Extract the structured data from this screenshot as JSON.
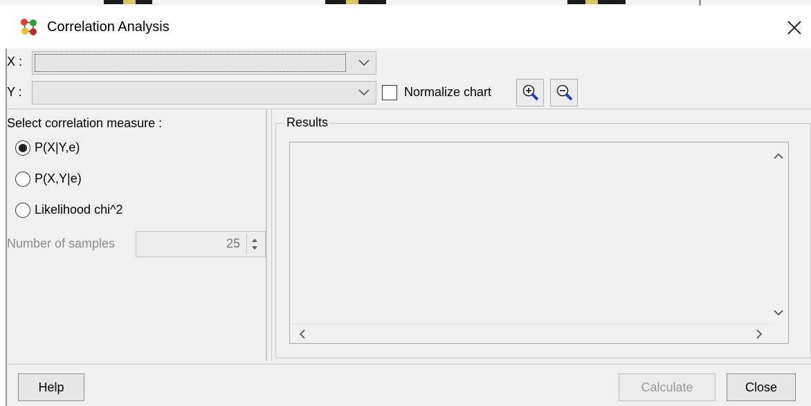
{
  "window": {
    "title": "Correlation Analysis"
  },
  "selectors": {
    "x_label": "X :",
    "y_label": "Y :",
    "x_value": "",
    "y_value": ""
  },
  "toolbar": {
    "normalize_label": "Normalize chart",
    "normalize_checked": false,
    "zoom_in_icon": "zoom-in-icon",
    "zoom_out_icon": "zoom-out-icon"
  },
  "measure": {
    "heading": "Select correlation measure :",
    "options": [
      {
        "label": "P(X|Y,e)",
        "selected": true
      },
      {
        "label": "P(X,Y|e)",
        "selected": false
      },
      {
        "label": "Likelihood chi^2",
        "selected": false
      }
    ],
    "samples_label": "Number of samples",
    "samples_value": "25"
  },
  "results": {
    "legend": "Results"
  },
  "buttons": {
    "help": "Help",
    "calculate": "Calculate",
    "close": "Close"
  },
  "colors": {
    "background": "#f0f0f0",
    "accent_zoom": "#1a3fd0"
  }
}
